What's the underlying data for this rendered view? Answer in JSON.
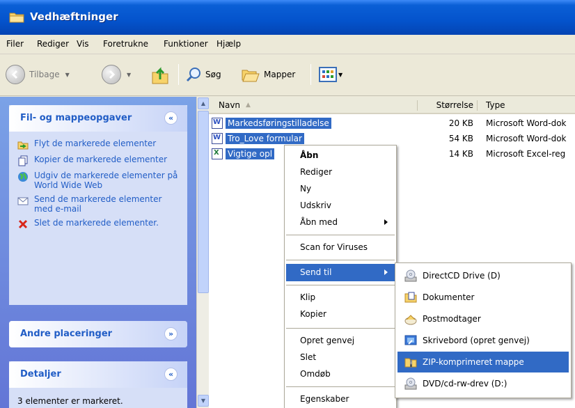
{
  "window": {
    "title": "Vedhæftninger"
  },
  "menubar": [
    "Filer",
    "Rediger",
    "Vis",
    "Foretrukne",
    "Funktioner",
    "Hjælp"
  ],
  "toolbar": {
    "back_label": "Tilbage",
    "search_label": "Søg",
    "folders_label": "Mapper"
  },
  "taskpane": {
    "file_tasks": {
      "title": "Fil- og mappeopgaver",
      "items": [
        {
          "label": "Flyt de markerede elementer",
          "icon": "move-icon"
        },
        {
          "label": "Kopier de markerede elementer",
          "icon": "copy-icon"
        },
        {
          "label": "Udgiv de markerede elementer på World Wide Web",
          "icon": "publish-web-icon"
        },
        {
          "label": "Send de markerede elementer med e-mail",
          "icon": "email-icon"
        },
        {
          "label": "Slet de markerede elementer.",
          "icon": "delete-icon"
        }
      ]
    },
    "other_places": {
      "title": "Andre placeringer"
    },
    "details": {
      "title": "Detaljer",
      "text": "3 elementer er markeret."
    }
  },
  "filelist": {
    "columns": {
      "name": "Navn",
      "size": "Størrelse",
      "type": "Type"
    },
    "rows": [
      {
        "name": "Markedsføringstilladelse",
        "size": "20 KB",
        "type": "Microsoft Word-dok",
        "kind": "word"
      },
      {
        "name": "Tro_Love formular",
        "size": "54 KB",
        "type": "Microsoft Word-dok",
        "kind": "word"
      },
      {
        "name": "Vigtige opl",
        "size": "14 KB",
        "type": "Microsoft Excel-reg",
        "kind": "excel"
      }
    ]
  },
  "context_menu": {
    "items": [
      "Åbn",
      "Rediger",
      "Ny",
      "Udskriv",
      "Åbn med",
      "Scan for Viruses",
      "Send til",
      "Klip",
      "Kopier",
      "Opret genvej",
      "Slet",
      "Omdøb",
      "Egenskaber"
    ],
    "highlighted": "Send til"
  },
  "send_to_menu": {
    "items": [
      {
        "label": "DirectCD Drive (D)",
        "icon": "cd-drive-icon"
      },
      {
        "label": "Dokumenter",
        "icon": "documents-folder-icon"
      },
      {
        "label": "Postmodtager",
        "icon": "mail-recipient-icon"
      },
      {
        "label": "Skrivebord (opret genvej)",
        "icon": "desktop-icon"
      },
      {
        "label": "ZIP-komprimeret mappe",
        "icon": "zip-folder-icon"
      },
      {
        "label": "DVD/cd-rw-drev (D:)",
        "icon": "dvd-drive-icon"
      }
    ],
    "highlighted": "ZIP-komprimeret mappe"
  },
  "colors": {
    "titlebar": "#0453cc",
    "selection": "#316ac5",
    "taskpane": "#7ba2e7",
    "task_link": "#215dc6"
  }
}
